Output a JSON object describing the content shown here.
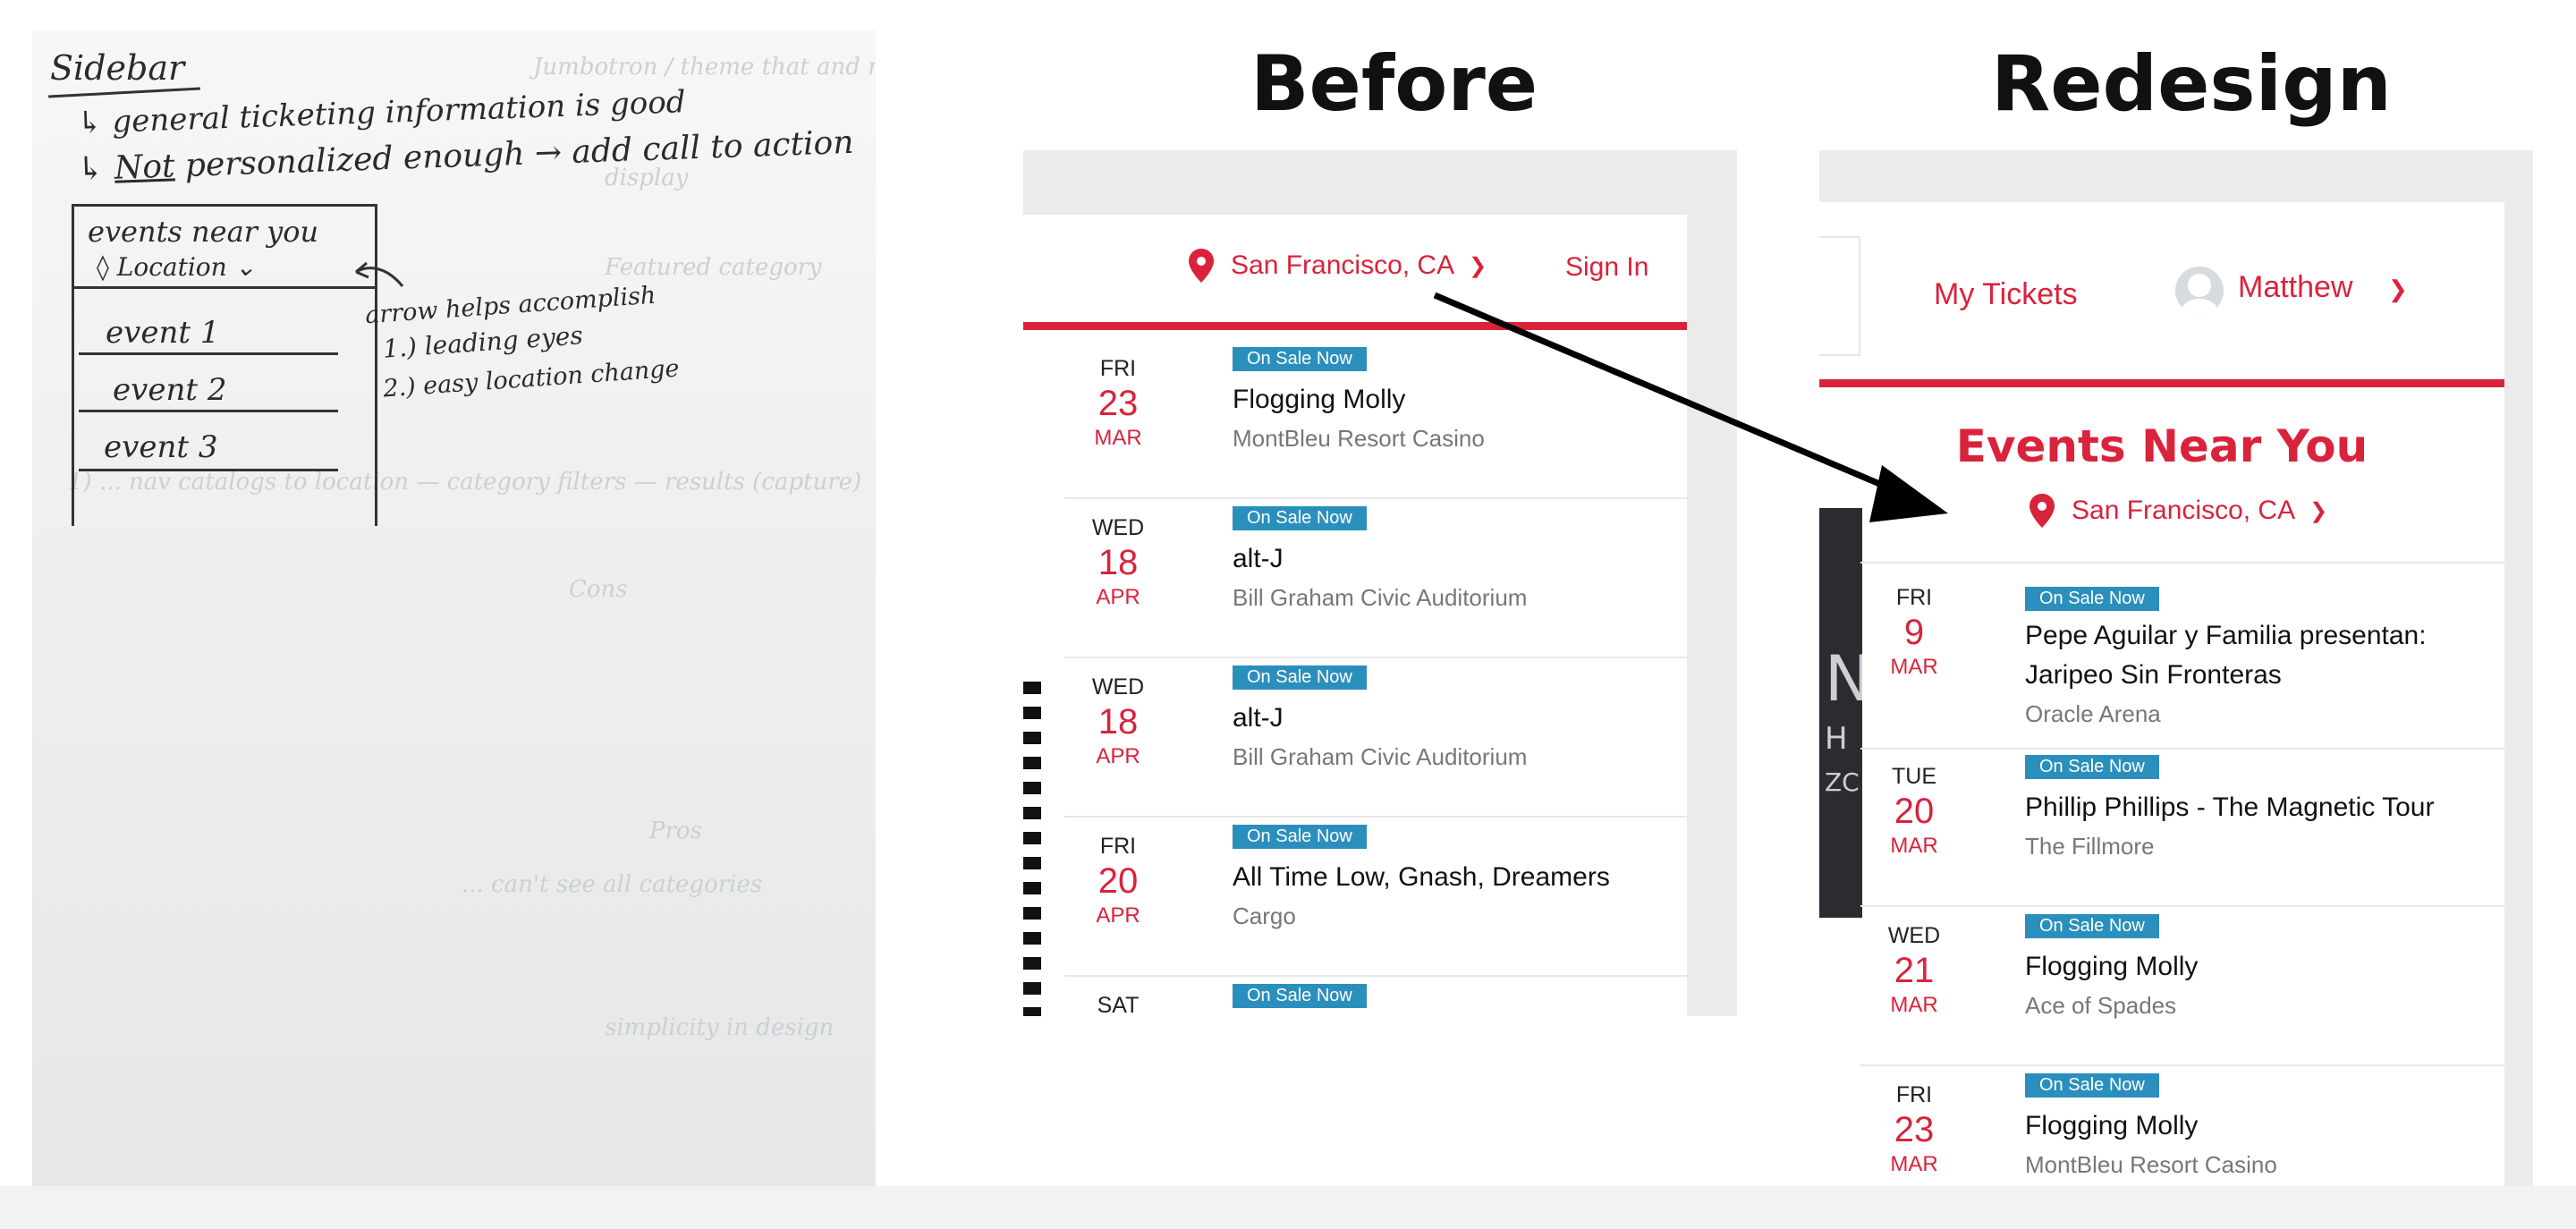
{
  "headings": {
    "before": "Before",
    "redesign": "Redesign"
  },
  "sketch": {
    "title": "Sidebar",
    "note1": "↳ general ticketing information is good",
    "note2_prefix": "↳ ",
    "note2_underlined": "Not",
    "note2_rest": " personalized enough → add call to action",
    "box_title": "events near you",
    "box_location": "◊ Location ⌄",
    "events": [
      "event 1",
      "event 2",
      "event 3"
    ],
    "arrow_note": "arrow helps accomplish",
    "arrow_reasons": [
      "1.) leading eyes",
      "2.) easy location change"
    ]
  },
  "before": {
    "location": "San Francisco, CA",
    "sign_in": "Sign In",
    "events": [
      {
        "dow": "FRI",
        "day": "23",
        "month": "MAR",
        "badge": "On Sale Now",
        "title": "Flogging Molly",
        "venue": "MontBleu Resort Casino"
      },
      {
        "dow": "WED",
        "day": "18",
        "month": "APR",
        "badge": "On Sale Now",
        "title": "alt-J",
        "venue": "Bill Graham Civic Auditorium"
      },
      {
        "dow": "WED",
        "day": "18",
        "month": "APR",
        "badge": "On Sale Now",
        "title": "alt-J",
        "venue": "Bill Graham Civic Auditorium"
      },
      {
        "dow": "FRI",
        "day": "20",
        "month": "APR",
        "badge": "On Sale Now",
        "title": "All Time Low, Gnash, Dreamers",
        "venue": "Cargo"
      },
      {
        "dow": "SAT",
        "day": "",
        "month": "",
        "badge": "On Sale Now",
        "title": "",
        "venue": ""
      }
    ]
  },
  "redesign": {
    "my_tickets": "My Tickets",
    "user_name": "Matthew",
    "section_title": "Events Near You",
    "location": "San Francisco, CA",
    "side_photo_text": [
      "N",
      "H",
      "ZC"
    ],
    "events": [
      {
        "dow": "FRI",
        "day": "9",
        "month": "MAR",
        "badge": "On Sale Now",
        "title": "Pepe Aguilar y Familia presentan:",
        "title2": "Jaripeo Sin Fronteras",
        "venue": "Oracle Arena"
      },
      {
        "dow": "TUE",
        "day": "20",
        "month": "MAR",
        "badge": "On Sale Now",
        "title": "Phillip Phillips - The Magnetic Tour",
        "title2": "",
        "venue": "The Fillmore"
      },
      {
        "dow": "WED",
        "day": "21",
        "month": "MAR",
        "badge": "On Sale Now",
        "title": "Flogging Molly",
        "title2": "",
        "venue": "Ace of Spades"
      },
      {
        "dow": "FRI",
        "day": "23",
        "month": "MAR",
        "badge": "On Sale Now",
        "title": "Flogging Molly",
        "title2": "",
        "venue": "MontBleu Resort Casino"
      }
    ]
  },
  "colors": {
    "brand_red": "#d9233c",
    "badge_blue": "#2b8fbd",
    "panel_gray": "#ebebeb"
  }
}
